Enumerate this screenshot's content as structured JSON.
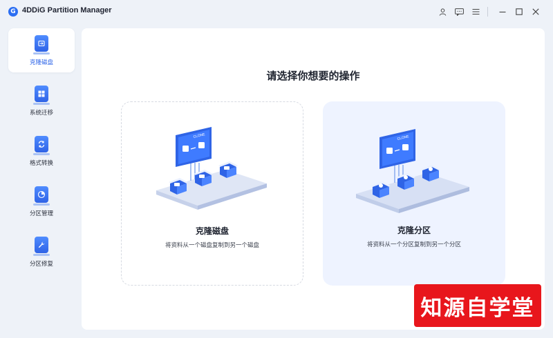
{
  "app": {
    "title": "4DDiG Partition Manager",
    "logo_glyph": "G",
    "accent_color": "#2b6ef2"
  },
  "titlebar_icons": [
    "user-icon",
    "feedback-icon",
    "menu-icon",
    "minimize-icon",
    "maximize-icon",
    "close-icon"
  ],
  "sidebar": {
    "items": [
      {
        "label": "克隆磁盘",
        "icon": "clone-disk-icon",
        "active": true
      },
      {
        "label": "系统迁移",
        "icon": "system-migrate-icon",
        "active": false
      },
      {
        "label": "格式转换",
        "icon": "format-convert-icon",
        "active": false
      },
      {
        "label": "分区管理",
        "icon": "partition-manage-icon",
        "active": false
      },
      {
        "label": "分区修复",
        "icon": "partition-repair-icon",
        "active": false
      }
    ]
  },
  "main": {
    "heading": "请选择你想要的操作",
    "cards": [
      {
        "title": "克隆磁盘",
        "description": "将资料从一个磁盘复制到另一个磁盘",
        "art_label": "CLONE"
      },
      {
        "title": "克隆分区",
        "description": "将资料从一个分区复制到另一个分区",
        "art_label": "CLONE"
      }
    ]
  },
  "watermark": {
    "text": "知源自学堂",
    "color": "#e8161c"
  }
}
